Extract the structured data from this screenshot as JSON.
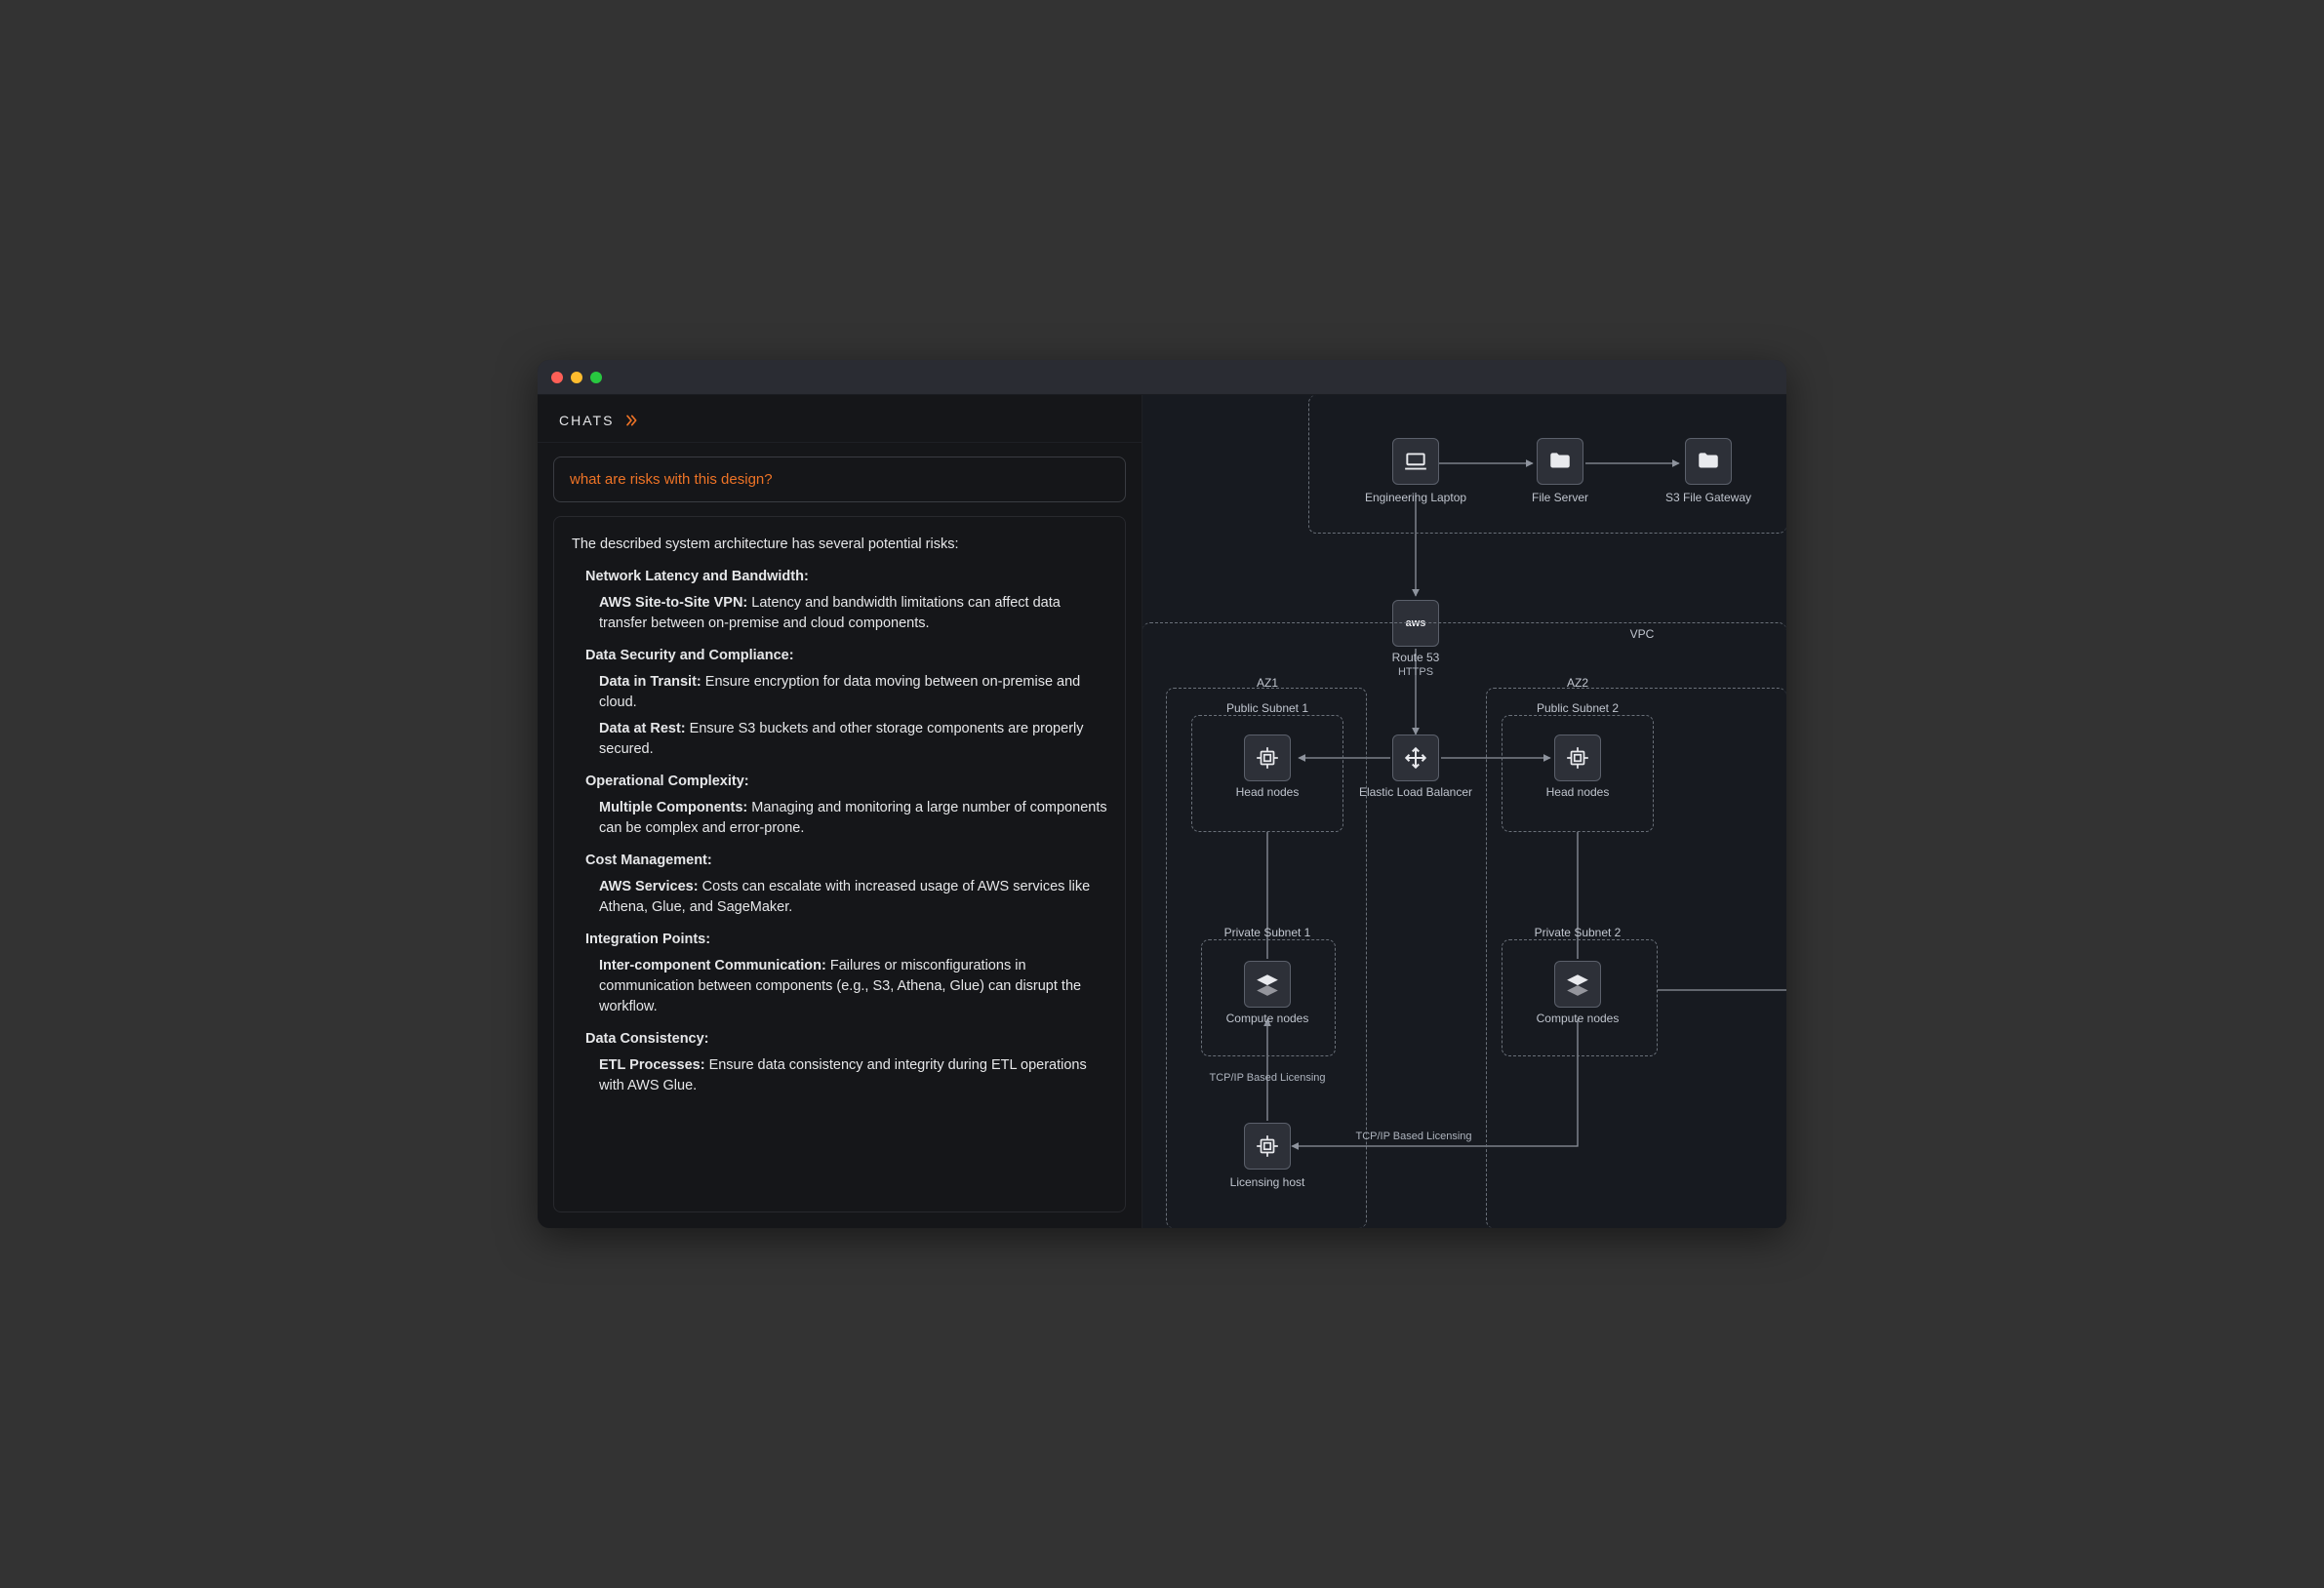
{
  "window": {
    "title": ""
  },
  "sidebar": {
    "chats_label": "CHATS"
  },
  "chat": {
    "question": "what are risks with this design?",
    "intro": "The described system architecture has several potential risks:",
    "sections": [
      {
        "title": "Network Latency and Bandwidth:",
        "items": [
          {
            "title": "AWS Site-to-Site VPN:",
            "body": " Latency and bandwidth limitations can affect data transfer between on-premise and cloud components."
          }
        ]
      },
      {
        "title": "Data Security and Compliance:",
        "items": [
          {
            "title": "Data in Transit:",
            "body": " Ensure encryption for data moving between on-premise and cloud."
          },
          {
            "title": "Data at Rest:",
            "body": " Ensure S3 buckets and other storage components are properly secured."
          }
        ]
      },
      {
        "title": "Operational Complexity:",
        "items": [
          {
            "title": "Multiple Components:",
            "body": " Managing and monitoring a large number of components can be complex and error-prone."
          }
        ]
      },
      {
        "title": "Cost Management:",
        "items": [
          {
            "title": "AWS Services:",
            "body": " Costs can escalate with increased usage of AWS services like Athena, Glue, and SageMaker."
          }
        ]
      },
      {
        "title": "Integration Points:",
        "items": [
          {
            "title": "Inter-component Communication:",
            "body": " Failures or misconfigurations in communication between components (e.g., S3, Athena, Glue) can disrupt the workflow."
          }
        ]
      },
      {
        "title": "Data Consistency:",
        "items": [
          {
            "title": "ETL Processes:",
            "body": " Ensure data consistency and integrity during ETL operations with AWS Glue."
          }
        ]
      }
    ]
  },
  "diagram": {
    "labels": {
      "eng_laptop": "Engineering Laptop",
      "file_server": "File Server",
      "s3_gateway": "S3 File Gateway",
      "route53": "Route 53",
      "https": "HTTPS",
      "vpc": "VPC",
      "az1": "AZ1",
      "az2": "AZ2",
      "pub1": "Public Subnet 1",
      "pub2": "Public Subnet 2",
      "priv1": "Private Subnet 1",
      "priv2": "Private Subnet 2",
      "head_nodes": "Head nodes",
      "elb": "Elastic Load Balancer",
      "compute": "Compute nodes",
      "licensing_host": "Licensing host",
      "tcpip": "TCP/IP Based Licensing"
    }
  }
}
